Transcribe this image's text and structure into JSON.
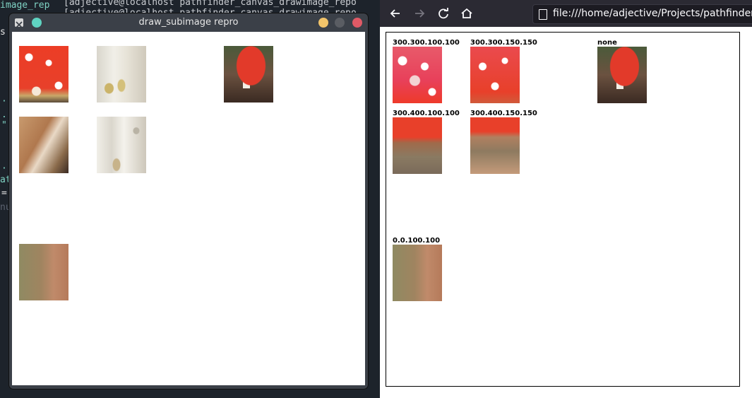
{
  "terminal": {
    "lines": [
      "[adjective@localhost pathfinder_canvas_drawimage_repo",
      "[adjective@localhost pathfinder_canvas_drawimage_repo"
    ],
    "fragments": [
      "image_rep",
      "s",
      "·",
      ".",
      "\"",
      "·",
      "at",
      "=",
      "nu"
    ]
  },
  "draw_window": {
    "title": "draw_subimage repro"
  },
  "browser": {
    "url": "file:///home/adjective/Projects/pathfinder_c",
    "labels": {
      "l1": "300.300.100.100",
      "l2": "300.300.150.150",
      "l3": "none",
      "l4": "300.400.100.100",
      "l5": "300.400.150.150",
      "l6": "0.0.100.100"
    }
  },
  "colors": {
    "red_cap": "#e8402a",
    "bark": "#ece9e1",
    "blur": "#9a7a5a",
    "browser_bg": "#2b2a33"
  }
}
